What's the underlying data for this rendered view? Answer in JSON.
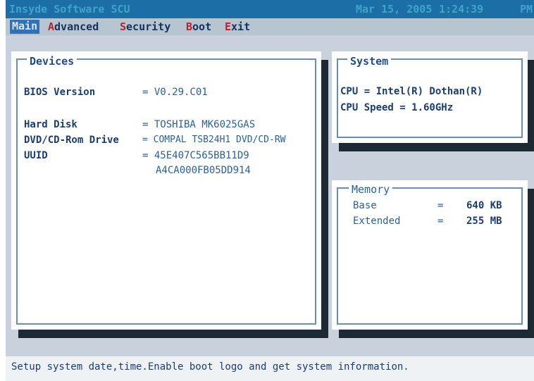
{
  "title_bar": {
    "app_title": "Insyde Software SCU",
    "date": "Mar 15, 2005",
    "time": "1:24:39",
    "ampm": "PM"
  },
  "menu": {
    "items": [
      {
        "label": "Main"
      },
      {
        "hot": "A",
        "rest": "dvanced"
      },
      {
        "hot": "S",
        "rest": "ecurity"
      },
      {
        "hot": "B",
        "rest": "oot"
      },
      {
        "hot": "E",
        "rest": "xit"
      }
    ]
  },
  "devices": {
    "title": "Devices",
    "bios_label": "BIOS Version",
    "bios_value": "= V0.29.C01",
    "hdd_label": "Hard Disk",
    "hdd_value": "= TOSHIBA MK6025GAS",
    "dvd_label": "DVD/CD-Rom Drive",
    "dvd_value": "= COMPAL TSB24H1 DVD/CD-RW",
    "uuid_label": "UUID",
    "uuid_value1": "= 45E407C565BB11D9",
    "uuid_value2": "A4CA000FB05DD914"
  },
  "system": {
    "title": "System",
    "cpu": "CPU = Intel(R) Dothan(R)",
    "cpu_speed": "CPU Speed = 1.60GHz"
  },
  "memory": {
    "title": "Memory",
    "base_label": "Base",
    "base_eq": "=",
    "base_value": "640 KB",
    "ext_label": "Extended",
    "ext_eq": "=",
    "ext_value": "255 MB"
  },
  "status": {
    "help_text": "Setup system date,time.Enable boot logo and get system information."
  },
  "colors": {
    "title_bar_bg": "#1c6fa6",
    "menu_bg": "#b7c5d1",
    "menu_active_bg": "#2f72b8",
    "hotkey": "#b5232b",
    "panel_bg": "#ffffff",
    "screen_bg": "#c9d2dc"
  }
}
